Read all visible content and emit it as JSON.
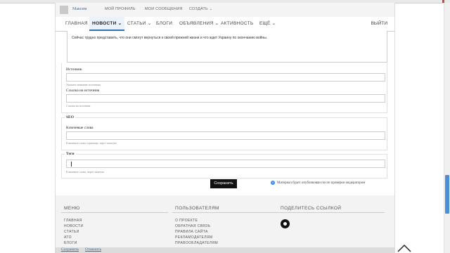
{
  "userbar": {
    "username": "Максим",
    "links": [
      "МОЙ ПРОФИЛЬ",
      "МОИ СООБЩЕНИЯ",
      "СОЗДАТЬ ⌄"
    ]
  },
  "nav": {
    "items": [
      "ГЛАВНАЯ",
      "НОВОСТИ ⌄",
      "СТАТЬИ ⌄",
      "БЛОГИ",
      "ОБЪЯВЛЕНИЯ ⌄",
      "АКТИВНОСТЬ",
      "ЕЩЁ ⌄"
    ],
    "active": "НОВОСТИ",
    "logout": "ВЫЙТИ"
  },
  "editor": {
    "text": "Сейчас трудно представить, что они смогут вернуться к своей прежней жизни и что ждет Украину по окончанию войны."
  },
  "source": {
    "label": "Источник",
    "hint": "Укажите название источника",
    "link_label": "Ссылка на источник",
    "link_hint": "Ссылка на источник"
  },
  "seo": {
    "legend": "SEO",
    "keywords_label": "Ключевые слова",
    "keywords_hint": "Ключевые слова страницы, через запятую"
  },
  "tags": {
    "legend": "Теги",
    "hint": "Ключевые слова, через запятую"
  },
  "actions": {
    "save": "Сохранить",
    "moderation_note": "Материал будет опубликован после проверки модератором"
  },
  "footer": {
    "menu_title": "МЕНЮ",
    "menu_links": [
      "ГЛАВНАЯ",
      "НОВОСТИ",
      "СТАТЬИ",
      "АТО",
      "БЛОГИ"
    ],
    "users_title": "ПОЛЬЗОВАТЕЛЯМ",
    "users_links": [
      "О ПРОЕКТЕ",
      "ОБРАТНАЯ СВЯЗЬ",
      "ПРАВИЛА САЙТА",
      "РЕКЛАМОДАТЕЛЯМ",
      "ПРАВООБЛАДАТЕЛЯМ"
    ],
    "share_title": "ПОДЕЛИТЕСЬ ССЫЛКОЙ"
  },
  "bottombar": {
    "save": "Сохранить",
    "cancel": "Отменить"
  },
  "colors": {
    "accent": "#2f6fb3",
    "save_button": "#111111",
    "info_icon": "#3a8ee6"
  }
}
